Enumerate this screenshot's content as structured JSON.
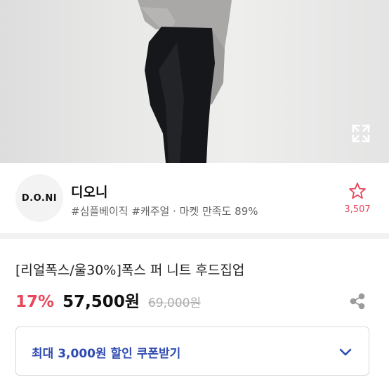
{
  "photo": {
    "expand_icon": "expand-icon"
  },
  "shop": {
    "logo_text": "D.O.NI",
    "name": "디오니",
    "meta": "#심플베이직 #캐주얼 · 마켓 만족도 89%",
    "favorite_icon": "star-outline-icon",
    "favorite_count": "3,507"
  },
  "product": {
    "title": "[리얼폭스/울30%]폭스 퍼 니트 후드집업",
    "discount": "17%",
    "price": "57,500원",
    "original_price": "69,000원",
    "share_icon": "share-icon"
  },
  "coupon": {
    "label": "최대 3,000원 할인 쿠폰받기",
    "chevron_icon": "chevron-down-icon"
  },
  "colors": {
    "accent_red": "#e8465b",
    "coupon_blue": "#2e4bb2",
    "divider": "#f2f2f2"
  }
}
